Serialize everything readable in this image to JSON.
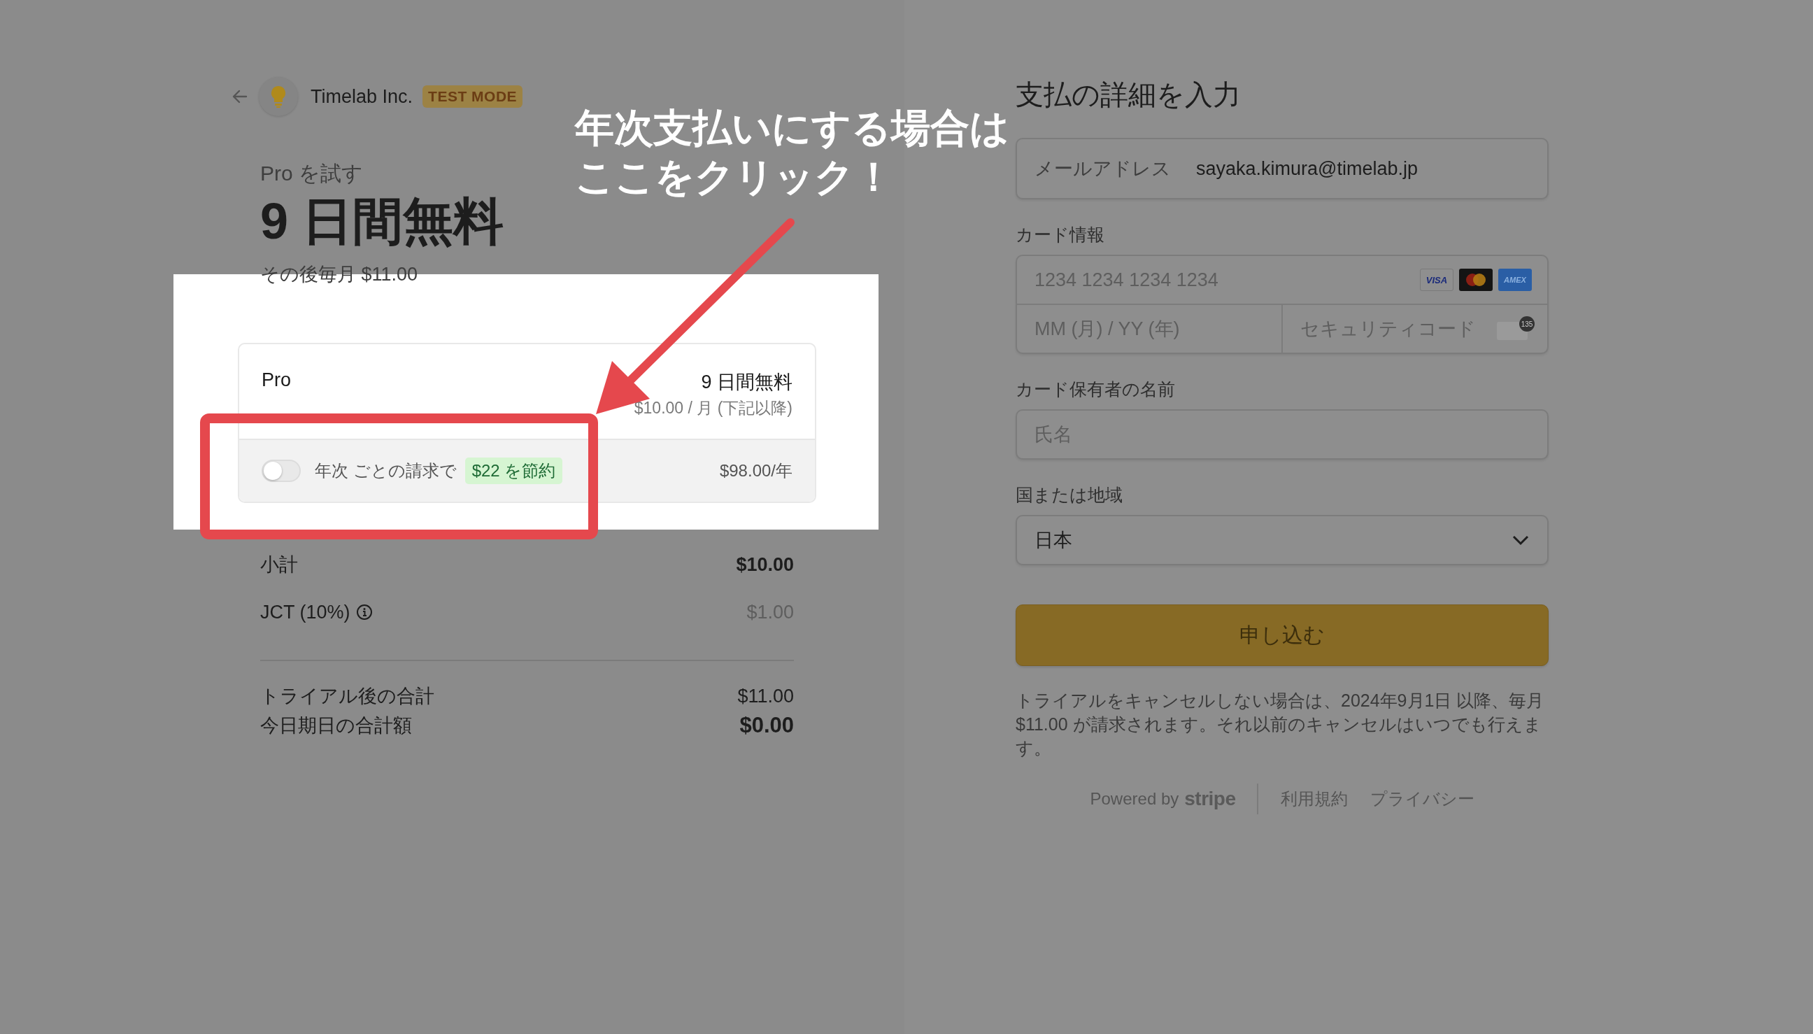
{
  "annotation": {
    "lines": [
      "年次支払いにする場合は",
      "ここをクリック！"
    ]
  },
  "header": {
    "company": "Timelab Inc.",
    "badge": "TEST MODE"
  },
  "summary": {
    "eyebrow": "Pro を試す",
    "headline": "9 日間無料",
    "subline": "その後毎月 $11.00"
  },
  "plan": {
    "name": "Pro",
    "trial": "9 日間無料",
    "price_note": "$10.00 / 月 (下記以降)",
    "annual": {
      "on": false,
      "label": "年次 ごとの請求で",
      "savings": "$22 を節約",
      "price": "$98.00/年"
    }
  },
  "totals": [
    {
      "kind": "subtotal",
      "label": "小計",
      "value": "$10.00"
    },
    {
      "kind": "tax",
      "label": "JCT (10%)",
      "value": "$1.00"
    },
    {
      "kind": "after_trial",
      "label": "トライアル後の合計",
      "value": "$11.00"
    },
    {
      "kind": "due_today",
      "label": "今日期日の合計額",
      "value": "$0.00"
    }
  ],
  "payment": {
    "title": "支払の詳細を入力",
    "email": {
      "label": "メールアドレス",
      "value": "sayaka.kimura@timelab.jp"
    },
    "card": {
      "label": "カード情報",
      "number_placeholder": "1234 1234 1234 1234",
      "brands": [
        {
          "kind": "visa",
          "text": "VISA"
        },
        {
          "kind": "mastercard"
        },
        {
          "kind": "amex",
          "text": "AMEX"
        }
      ],
      "expiry_placeholder": "MM (月) / YY (年)",
      "cvc_placeholder": "セキュリティコード",
      "cvc_digits": "135"
    },
    "name": {
      "label": "カード保有者の名前",
      "placeholder": "氏名"
    },
    "country": {
      "label": "国または地域",
      "value": "日本"
    },
    "submit": "申し込む",
    "terms": "トライアルをキャンセルしない場合は、2024年9月1日 以降、毎月 $11.00 が請求されます。それ以前のキャンセルはいつでも行えます。",
    "footer": {
      "powered_by": "Powered by",
      "brand": "stripe",
      "links": [
        "利用規約",
        "プライバシー"
      ]
    }
  }
}
